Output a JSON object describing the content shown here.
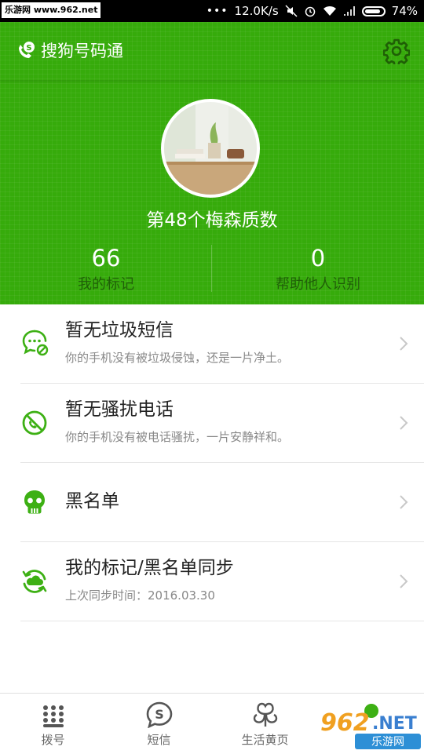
{
  "statusbar": {
    "watermark": "乐游网 www.962.net",
    "signal_dots": "•••",
    "speed": "12.0K/s",
    "battery": "74%"
  },
  "header": {
    "app_title": "搜狗号码通",
    "user_name": "第48个梅森质数",
    "stats": [
      {
        "value": "66",
        "label": "我的标记"
      },
      {
        "value": "0",
        "label": "帮助他人识别"
      }
    ]
  },
  "list": [
    {
      "icon": "spam-sms-icon",
      "title": "暂无垃圾短信",
      "subtitle": "你的手机没有被垃圾侵蚀，还是一片净土。"
    },
    {
      "icon": "harass-call-block-icon",
      "title": "暂无骚扰电话",
      "subtitle": "你的手机没有被电话骚扰，一片安静祥和。"
    },
    {
      "icon": "skull-icon",
      "title": "黑名单",
      "subtitle": ""
    },
    {
      "icon": "cloud-sync-icon",
      "title": "我的标记/黑名单同步",
      "subtitle": "上次同步时间：2016.03.30"
    }
  ],
  "bottomnav": {
    "tabs": [
      {
        "icon": "dialpad-icon",
        "label": "拨号"
      },
      {
        "icon": "sms-icon",
        "label": "短信"
      },
      {
        "icon": "clover-icon",
        "label": "生活黄页"
      },
      {
        "icon": "profile-icon",
        "label": ""
      }
    ],
    "watermark": "962.NET 乐游网"
  },
  "colors": {
    "brand_green": "#36ab0b",
    "icon_green": "#3db014"
  }
}
